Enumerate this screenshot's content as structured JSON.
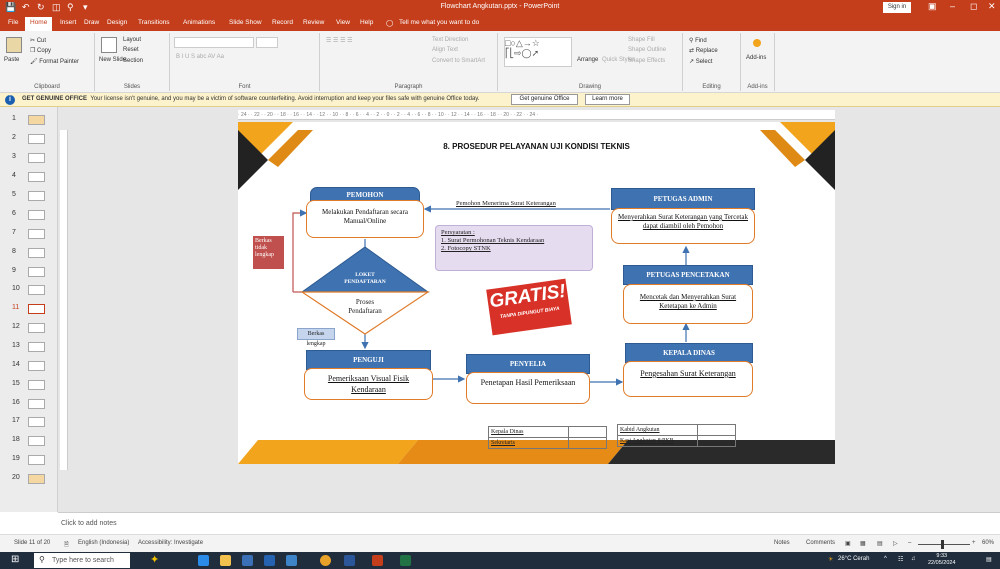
{
  "window": {
    "title": "Flowchart Angkutan.pptx - PowerPoint",
    "signin": "Sign in"
  },
  "tabs": [
    "File",
    "Home",
    "Insert",
    "Draw",
    "Design",
    "Transitions",
    "Animations",
    "Slide Show",
    "Record",
    "Review",
    "View",
    "Help"
  ],
  "tell_me": "Tell me what you want to do",
  "ribbon": {
    "clipboard": {
      "paste": "Paste",
      "cut": "Cut",
      "copy": "Copy",
      "format_painter": "Format Painter",
      "label": "Clipboard"
    },
    "slides": {
      "new_slide": "New Slide",
      "layout": "Layout",
      "reset": "Reset",
      "section": "Section",
      "label": "Slides"
    },
    "font": {
      "label": "Font",
      "styles": "B  I  U  S  abc  AV  Aa"
    },
    "paragraph": {
      "label": "Paragraph",
      "text_direction": "Text Direction",
      "align_text": "Align Text",
      "smartart": "Convert to SmartArt"
    },
    "drawing": {
      "arrange": "Arrange",
      "quick_styles": "Quick Styles",
      "shape_fill": "Shape Fill",
      "shape_outline": "Shape Outline",
      "shape_effects": "Shape Effects",
      "label": "Drawing"
    },
    "editing": {
      "find": "Find",
      "replace": "Replace",
      "select": "Select",
      "label": "Editing"
    },
    "addins": {
      "button": "Add-ins",
      "label": "Add-ins"
    }
  },
  "infobar": {
    "title": "GET GENUINE OFFICE",
    "message": "Your license isn't genuine, and you may be a victim of software counterfeiting. Avoid interruption and keep your files safe with genuine Office today.",
    "btn_genuine": "Get genuine Office",
    "btn_learn": "Learn more"
  },
  "thumbnails": [
    "1",
    "2",
    "3",
    "4",
    "5",
    "6",
    "7",
    "8",
    "9",
    "10",
    "11",
    "12",
    "13",
    "14",
    "15",
    "16",
    "17",
    "18",
    "19",
    "20"
  ],
  "ruler": "· 24 · · 22 · · 20 · · 18 · · 16 · · 14 · · 12 · · 10 · · 8 · · 6 · · 4 · · 2 · · 0 · · 2 · · 4 · · 6 · · 8 · · 10 · · 12 · · 14 · · 16 · · 18 · · 20 · · 22 · · 24 ·",
  "slide": {
    "title": "8.  PROSEDUR PELAYANAN UJI KONDISI TEKNIS",
    "pemohon_head": "PEMOHON",
    "pemohon_body": "Melakukan Pendaftaran secara Manual/Online",
    "arrow_label": "Pemohon Menerima Surat Keterangan",
    "admin_head": "PETUGAS ADMIN",
    "admin_body": "Menyerahkan Surat Keterangan yang Tercetak dapat diambil oleh Pemohon",
    "persyaratan_title": "Persyaratan :",
    "persyaratan_1": "1.  Surat Permohonan Teknis Kendaraan",
    "persyaratan_2": "2.  Fotocopy STNK",
    "berkas_tidak": "Berkas tidak lengkap",
    "loket": "LOKET PENDAFTARAN",
    "proses": "Proses Pendaftaran",
    "pencetakan_head": "PETUGAS PENCETAKAN",
    "pencetakan_body": "Mencetak dan Menyerahkan Surat Ketetapan ke Admin",
    "gratis": "GRATIS!",
    "gratis_sub": "TANPA DIPUNGUT BIAYA",
    "berkas_lengkap": "Berkas lengkap",
    "penguji_head": "PENGUJI",
    "penguji_body": "Pemeriksaan Visual Fisik Kendaraan",
    "penyelia_head": "PENYELIA",
    "penyelia_body": "Penetapan Hasil Pemeriksaan",
    "kadis_head": "KEPALA DINAS",
    "kadis_body": "Pengesahan Surat Keterangan",
    "sig_left": [
      "Kepala Dinas",
      "Sekretaris"
    ],
    "sig_right": [
      "Kabid Angkutan",
      "Kasi Angkutan &PKB"
    ]
  },
  "notes_placeholder": "Click to add notes",
  "status": {
    "slide": "Slide 11 of 20",
    "language": "English (Indonesia)",
    "accessibility": "Accessibility: Investigate",
    "notes": "Notes",
    "comments": "Comments",
    "zoom": "60%"
  },
  "taskbar": {
    "search": "Type here to search",
    "weather": "26°C  Cerah",
    "time": "9:33",
    "date": "22/05/2024"
  }
}
